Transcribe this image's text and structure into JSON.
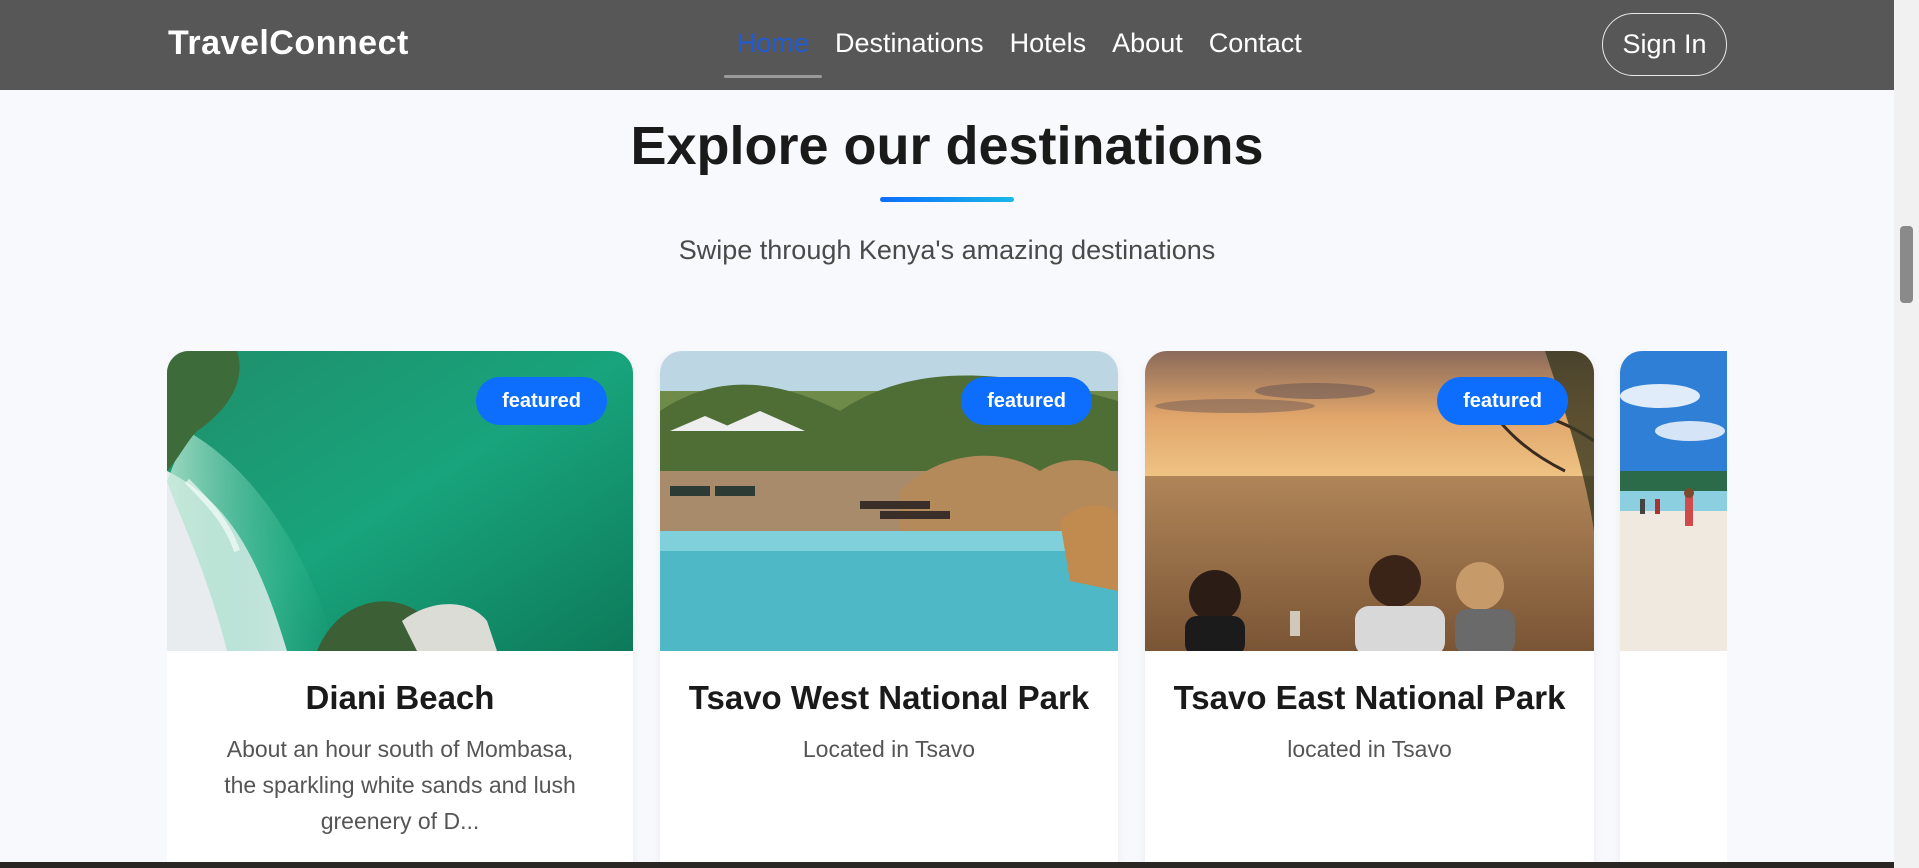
{
  "navbar": {
    "brand": "TravelConnect",
    "links": [
      "Home",
      "Destinations",
      "Hotels",
      "About",
      "Contact"
    ],
    "active_link": "Home",
    "sign_in_label": "Sign In"
  },
  "section": {
    "title": "Explore our destinations",
    "subtitle": "Swipe through Kenya's amazing destinations"
  },
  "cards": [
    {
      "title": "Diani Beach",
      "description": "About an hour south of Mombasa, the sparkling white sands and lush greenery of D...",
      "badge": "featured",
      "image": "aerial-beach-photo"
    },
    {
      "title": "Tsavo West National Park",
      "description": "Located in Tsavo",
      "badge": "featured",
      "image": "lodge-pool-photo"
    },
    {
      "title": "Tsavo East National Park",
      "description": "located in Tsavo",
      "badge": "featured",
      "image": "sunset-savanna-photo"
    },
    {
      "title": "",
      "description": "",
      "badge": "",
      "image": "beach-people-photo"
    }
  ],
  "colors": {
    "navbar_bg": "#575757",
    "active_link": "#1f5bd6",
    "badge_bg": "#0d6efd",
    "page_bg": "#f8f9fc"
  }
}
